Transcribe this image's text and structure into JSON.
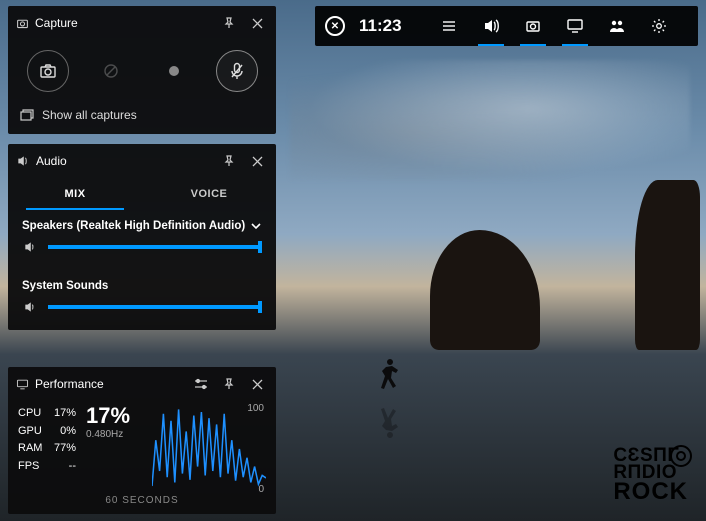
{
  "topbar": {
    "time": "11:23"
  },
  "capture": {
    "title": "Capture",
    "show_all": "Show all captures"
  },
  "audio": {
    "title": "Audio",
    "tab_mix": "MIX",
    "tab_voice": "VOICE",
    "device_label": "Speakers (Realtek High Definition Audio)",
    "device_volume_pct": 98,
    "system_label": "System Sounds",
    "system_volume_pct": 98
  },
  "performance": {
    "title": "Performance",
    "cpu_label": "CPU",
    "cpu_value": "17%",
    "gpu_label": "GPU",
    "gpu_value": "0%",
    "ram_label": "RAM",
    "ram_value": "77%",
    "fps_label": "FPS",
    "fps_value": "--",
    "headline": "17%",
    "subline": "0.480Hz",
    "x_axis_label": "60 SECONDS",
    "y_max": "100",
    "y_min": "0"
  },
  "chart_data": {
    "type": "line",
    "title": "CPU usage",
    "xlabel": "60 SECONDS",
    "ylabel": "%",
    "ylim": [
      0,
      100
    ],
    "x": [
      0,
      2,
      4,
      6,
      8,
      10,
      12,
      14,
      16,
      18,
      20,
      22,
      24,
      26,
      28,
      30,
      32,
      34,
      36,
      38,
      40,
      42,
      44,
      46,
      48,
      50,
      52,
      54,
      56,
      58,
      60
    ],
    "values": [
      8,
      60,
      25,
      90,
      18,
      82,
      12,
      95,
      22,
      70,
      15,
      88,
      30,
      92,
      20,
      85,
      25,
      78,
      18,
      90,
      22,
      60,
      14,
      50,
      18,
      40,
      12,
      30,
      10,
      20,
      17
    ]
  },
  "watermark": {
    "line1": "CƐSΠΓ",
    "line2": "RΠDIO",
    "line3": "ROCK"
  }
}
